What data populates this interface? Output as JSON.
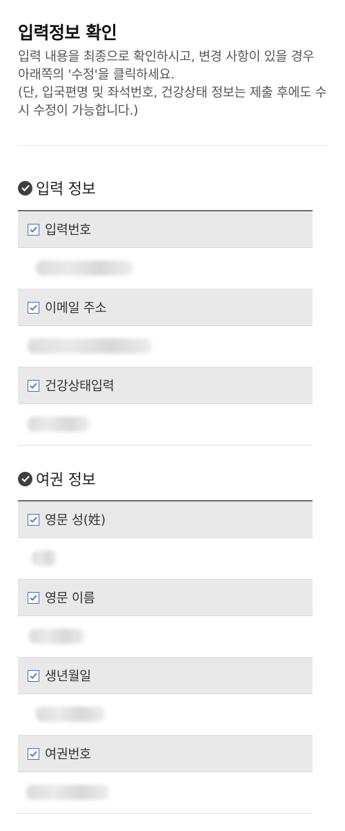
{
  "header": {
    "title": "입력정보 확인",
    "intro_line1": "입력 내용을 최종으로 확인하시고, 변경 사항이 있을 경우 아래쪽의 '수정'을 클릭하세요.",
    "intro_line2": "(단, 입국편명 및 좌석번호, 건강상태 정보는 제출 후에도 수시 수정이 가능합니다.)"
  },
  "sections": [
    {
      "title": "입력 정보",
      "fields": [
        {
          "label": "입력번호",
          "value": ""
        },
        {
          "label": "이메일 주소",
          "value": ""
        },
        {
          "label": "건강상태입력",
          "value": ""
        }
      ]
    },
    {
      "title": "여권 정보",
      "fields": [
        {
          "label": "영문 성(姓)",
          "value": ""
        },
        {
          "label": "영문 이름",
          "value": ""
        },
        {
          "label": "생년월일",
          "value": ""
        },
        {
          "label": "여권번호",
          "value": ""
        }
      ]
    }
  ],
  "colors": {
    "checkbox_border": "#3a6fc2",
    "header_bg": "#e9e9e9",
    "section_icon": "#3f3f3f"
  },
  "icons": {
    "section_icon": "check-circle-icon",
    "field_icon": "checkbox-checked-icon"
  }
}
